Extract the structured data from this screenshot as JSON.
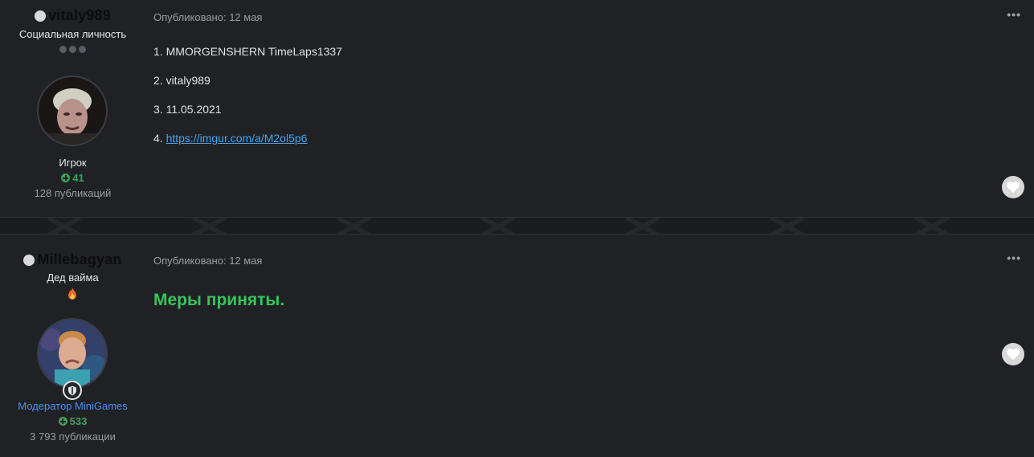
{
  "posts": [
    {
      "author": {
        "name": "vitaly989",
        "title": "Социальная личность",
        "group": "Игрок",
        "reputation": "41",
        "posts_count": "128 публикаций"
      },
      "published": "Опубликовано: 12 мая",
      "content": {
        "line1": "1. MMORGENSHERN TimeLaps1337",
        "line2": "2. vitaly989",
        "line3": "3. 11.05.2021",
        "line4_prefix": "4. ",
        "line4_link": "https://imgur.com/a/M2ol5p6"
      },
      "menu_label": "•••"
    },
    {
      "author": {
        "name": "Millebagyan",
        "title": "Дед вайма",
        "group": "Модератор MiniGames",
        "reputation": "533",
        "posts_count": "3 793 публикации"
      },
      "published": "Опубликовано: 12 мая",
      "content": {
        "text": "Меры приняты."
      },
      "menu_label": "•••"
    }
  ],
  "colors": {
    "background": "#1f2125",
    "link": "#4aa3e8",
    "moderator": "#4e8ff0",
    "reputation": "#3da35a",
    "highlight_text": "#37c55b"
  },
  "icons": {
    "status": "offline-dot-icon",
    "rank_post1": "rank-dots-icon",
    "rank_post2": "fire-icon",
    "reputation": "plus-circle-icon",
    "moderator": "shield-icon",
    "like": "heart-icon",
    "menu": "ellipsis-icon"
  }
}
